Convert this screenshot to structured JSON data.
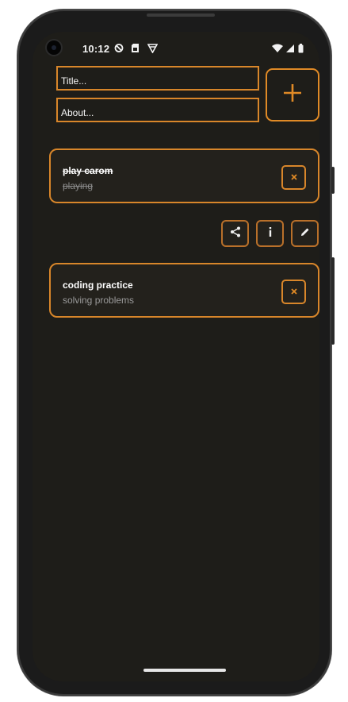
{
  "status_bar": {
    "time": "10:12",
    "icons_left": [
      "no-disturb-icon",
      "sim-card-icon",
      "vpn-icon"
    ],
    "icons_right": [
      "wifi-icon",
      "signal-icon",
      "battery-icon"
    ]
  },
  "form": {
    "title_placeholder": "Title...",
    "about_placeholder": "About...",
    "add_icon": "plus-icon"
  },
  "tasks": [
    {
      "title": "play carom",
      "subtitle": "playing",
      "done": true
    },
    {
      "title": "coding practice",
      "subtitle": "solving problems",
      "done": false
    }
  ],
  "actions": [
    "share-icon",
    "info-icon",
    "edit-icon"
  ],
  "colors": {
    "accent": "#e08a26",
    "background": "#1e1d19",
    "card": "#23211c",
    "text": "#ffffff",
    "muted": "#9a9a9a"
  }
}
